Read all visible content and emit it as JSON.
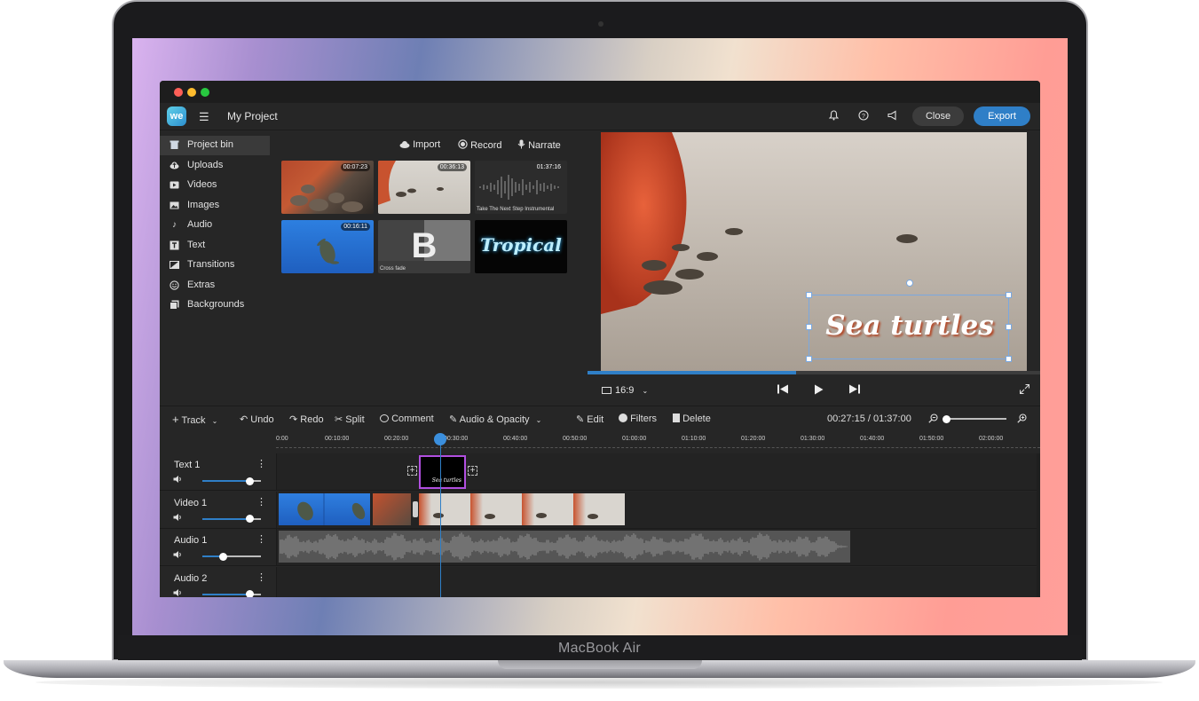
{
  "device": {
    "label": "MacBook Air"
  },
  "app": {
    "project_title": "My Project",
    "logo_text": "we",
    "actions": {
      "close": "Close",
      "export": "Export"
    },
    "top_icons": [
      "bell-icon",
      "help-icon",
      "announce-icon"
    ]
  },
  "sidebar": {
    "items": [
      {
        "label": "Project bin",
        "icon": "bin-icon",
        "active": true
      },
      {
        "label": "Uploads",
        "icon": "upload-cloud-icon"
      },
      {
        "label": "Videos",
        "icon": "video-icon"
      },
      {
        "label": "Images",
        "icon": "image-icon"
      },
      {
        "label": "Audio",
        "icon": "music-note-icon"
      },
      {
        "label": "Text",
        "icon": "text-icon"
      },
      {
        "label": "Transitions",
        "icon": "transition-icon"
      },
      {
        "label": "Extras",
        "icon": "smiley-icon"
      },
      {
        "label": "Backgrounds",
        "icon": "backgrounds-icon"
      }
    ]
  },
  "media": {
    "import": "Import",
    "record": "Record",
    "narrate": "Narrate",
    "items": [
      {
        "duration": "00:07:23"
      },
      {
        "duration": "00:36:13"
      },
      {
        "duration": "01:37:16",
        "caption": "Take The Next Step Instrumental"
      },
      {
        "duration": "00:16:11"
      },
      {
        "caption": "Cross fade",
        "letter": "B"
      },
      {
        "title": "Tropical"
      }
    ]
  },
  "preview": {
    "overlay_text": "Sea turtles",
    "aspect": "16:9",
    "progress": 0.46
  },
  "timeline_toolbar": {
    "track": "Track",
    "undo": "Undo",
    "redo": "Redo",
    "split": "Split",
    "comment": "Comment",
    "audio_opacity": "Audio & Opacity",
    "edit": "Edit",
    "filters": "Filters",
    "delete": "Delete",
    "timecode": "00:27:15 / 01:37:00"
  },
  "ruler": [
    "0:00",
    "00:10:00",
    "00:20:00",
    "00:30:00",
    "00:40:00",
    "00:50:00",
    "01:00:00",
    "01:10:00",
    "01:20:00",
    "01:30:00",
    "01:40:00",
    "01:50:00",
    "02:00:00"
  ],
  "tracks": [
    {
      "name": "Text 1",
      "volume": 0.8
    },
    {
      "name": "Video 1",
      "volume": 0.8
    },
    {
      "name": "Audio 1",
      "volume": 0.35
    },
    {
      "name": "Audio 2",
      "volume": 0.8
    }
  ],
  "text_clip_label": "Sea turtles",
  "colors": {
    "accent": "#2f7fc7",
    "selection": "#b14fe0"
  }
}
